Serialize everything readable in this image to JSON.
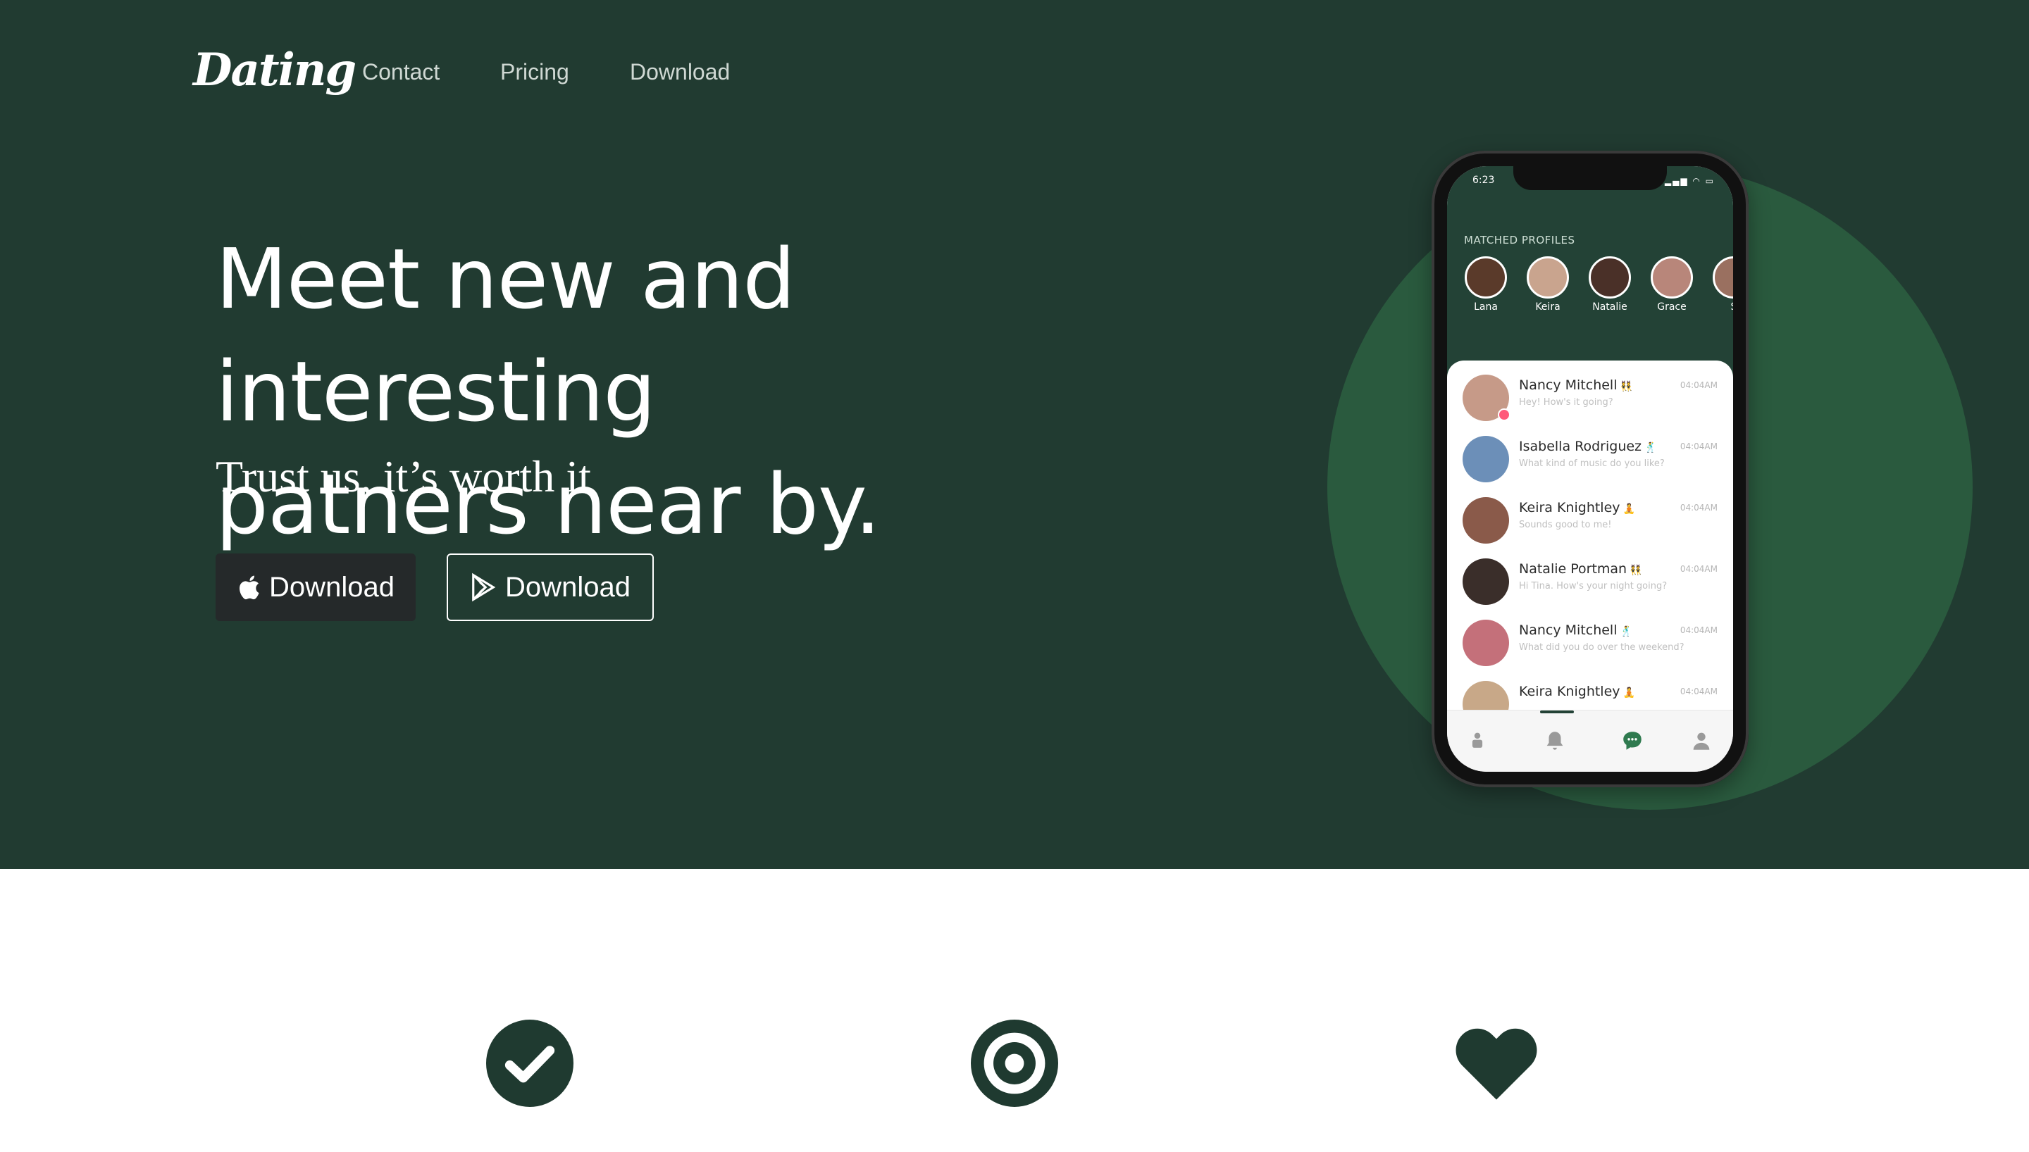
{
  "nav": {
    "logo": "Dating",
    "links": [
      "Contact",
      "Pricing",
      "Download"
    ]
  },
  "hero": {
    "headline_line1": "Meet new and interesting",
    "headline_line2": "patners near by.",
    "subtitle": "Trust us, it’s worth it",
    "buttons": {
      "apple_label": "Download",
      "play_label": "Download"
    }
  },
  "phone": {
    "time": "6:23",
    "matched_title": "MATCHED  PROFILES",
    "matched": [
      {
        "name": "Lana",
        "color": "#5a3a2a"
      },
      {
        "name": "Keira",
        "color": "#c9a48e"
      },
      {
        "name": "Natalie",
        "color": "#4a3028"
      },
      {
        "name": "Grace",
        "color": "#b8867a"
      },
      {
        "name": "S",
        "color": "#9a7060"
      }
    ],
    "chats": [
      {
        "name": "Nancy Mitchell",
        "emoji": "👯",
        "message": "Hey! How's it going?",
        "time": "04:04AM",
        "color": "#c69a88",
        "unread": true
      },
      {
        "name": "Isabella Rodriguez",
        "emoji": "🕺",
        "message": "What kind of music do you like?",
        "time": "04:04AM",
        "color": "#6c8fb8",
        "unread": false
      },
      {
        "name": "Keira Knightley",
        "emoji": "🧘",
        "message": "Sounds good to me!",
        "time": "04:04AM",
        "color": "#8a5a4a",
        "unread": false
      },
      {
        "name": "Natalie Portman",
        "emoji": "👯",
        "message": "Hi Tina. How's your night going?",
        "time": "04:04AM",
        "color": "#3a2e2a",
        "unread": false
      },
      {
        "name": "Nancy Mitchell",
        "emoji": "🕺",
        "message": "What did you do over the weekend?",
        "time": "04:04AM",
        "color": "#c4707a",
        "unread": false
      },
      {
        "name": "Keira Knightley",
        "emoji": "🧘",
        "message": "",
        "time": "04:04AM",
        "color": "#c8a888",
        "unread": false
      }
    ]
  },
  "colors": {
    "hero_bg": "#213b31",
    "accent_circle": "#2a5a3e",
    "icon": "#1f3a30"
  }
}
